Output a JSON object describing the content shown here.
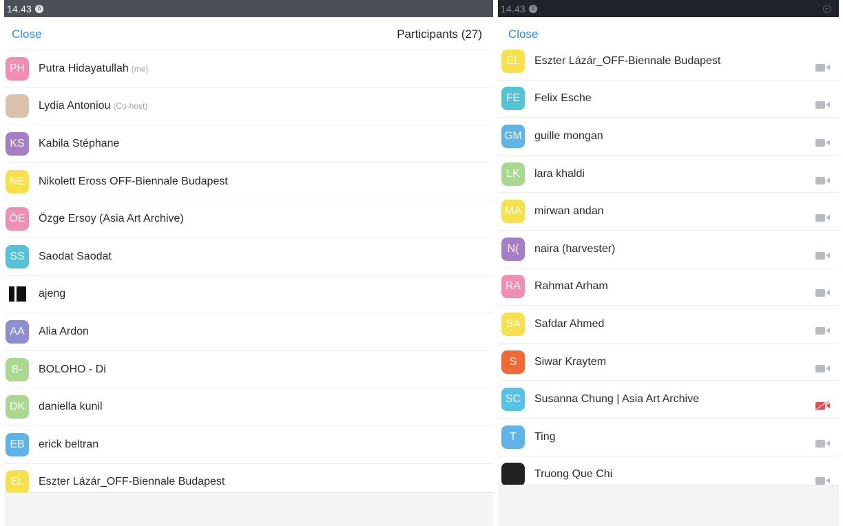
{
  "left": {
    "status_time": "14.43",
    "status_badge": "6",
    "close_label": "Close",
    "title": "Participants (27)",
    "participants": [
      {
        "initials": "PH",
        "name": "Putra Hidayatullah",
        "tag": "(me)",
        "color": "#f08fb2"
      },
      {
        "initials": "",
        "name": "Lydia Antoniou",
        "tag": "(Co-host)",
        "color": "#d9c3ae"
      },
      {
        "initials": "KS",
        "name": "Kabila Stéphane",
        "tag": "",
        "color": "#a57ec6"
      },
      {
        "initials": "NE",
        "name": "Nikolett Eross OFF-Biennale Budapest",
        "tag": "",
        "color": "#f6e04b"
      },
      {
        "initials": "ÖE",
        "name": "Özge Ersoy (Asia Art Archive)",
        "tag": "",
        "color": "#ef8fb3"
      },
      {
        "initials": "SS",
        "name": "Saodat Saodat",
        "tag": "",
        "color": "#55c2d6"
      },
      {
        "initials": "",
        "name": "ajeng",
        "tag": "",
        "color": "#ffffff"
      },
      {
        "initials": "AA",
        "name": "Alia Ardon",
        "tag": "",
        "color": "#8c8ed2"
      },
      {
        "initials": "B-",
        "name": "BOLOHO - Di",
        "tag": "",
        "color": "#a8d98e"
      },
      {
        "initials": "DK",
        "name": "daniella kunil",
        "tag": "",
        "color": "#a8d98e"
      },
      {
        "initials": "EB",
        "name": "erick beltran",
        "tag": "",
        "color": "#5fb3e6"
      },
      {
        "initials": "EL",
        "name": "Eszter Lázár_OFF-Biennale Budapest",
        "tag": "",
        "color": "#f6e04b"
      }
    ]
  },
  "right": {
    "status_time": "14.43",
    "status_badge": "6",
    "close_label": "Close",
    "participants": [
      {
        "initials": "EL",
        "name": "Eszter Lázár_OFF-Biennale Budapest",
        "color": "#f6e04b",
        "video": "on"
      },
      {
        "initials": "FE",
        "name": "Felix Esche",
        "color": "#55c2d6",
        "video": "on"
      },
      {
        "initials": "GM",
        "name": "guille mongan",
        "color": "#5fb3e6",
        "video": "on"
      },
      {
        "initials": "LK",
        "name": "lara khaldi",
        "color": "#a8d98e",
        "video": "on"
      },
      {
        "initials": "MA",
        "name": "mirwan andan",
        "color": "#f6e04b",
        "video": "on"
      },
      {
        "initials": "N(",
        "name": "naira (harvester)",
        "color": "#a57ec6",
        "video": "on"
      },
      {
        "initials": "RA",
        "name": "Rahmat Arham",
        "color": "#ef8fb3",
        "video": "on"
      },
      {
        "initials": "SA",
        "name": "Safdar Ahmed",
        "color": "#f6e04b",
        "video": "on"
      },
      {
        "initials": "S",
        "name": "Siwar Kraytem",
        "color": "#f06a37",
        "video": "on"
      },
      {
        "initials": "SC",
        "name": "Susanna Chung | Asia Art Archive",
        "color": "#55c2e6",
        "video": "off"
      },
      {
        "initials": "T",
        "name": "Ting",
        "color": "#5fb3e6",
        "video": "on"
      },
      {
        "initials": "",
        "name": "Truong Que Chi",
        "color": "#222222",
        "video": "on"
      }
    ]
  }
}
